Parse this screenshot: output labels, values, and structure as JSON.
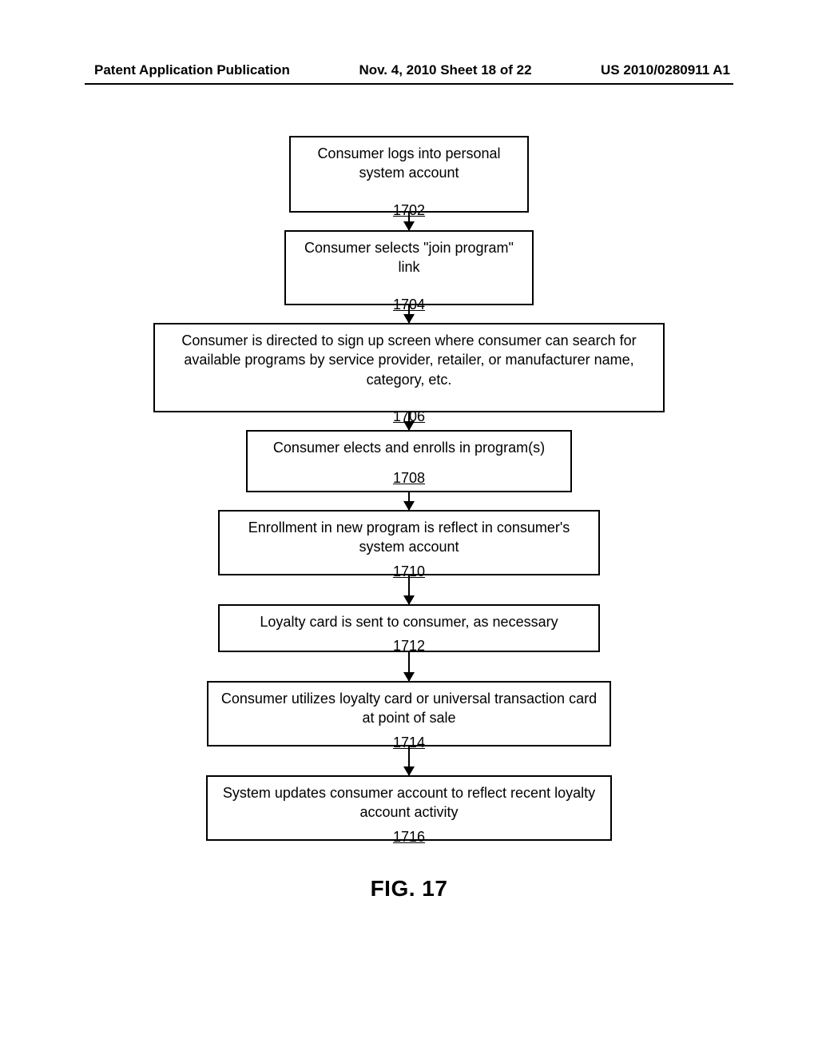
{
  "header": {
    "left": "Patent Application Publication",
    "center": "Nov. 4, 2010   Sheet 18 of 22",
    "right": "US 2010/0280911 A1"
  },
  "figure": {
    "label": "FIG. 17",
    "steps": [
      {
        "id": "1702",
        "text": "Consumer logs into personal system account",
        "ref": "1702"
      },
      {
        "id": "1704",
        "text": "Consumer selects \"join program\" link",
        "ref": "1704"
      },
      {
        "id": "1706",
        "text": "Consumer is directed to sign up screen where consumer can search for available programs by service provider, retailer, or manufacturer name, category, etc.",
        "ref": "1706"
      },
      {
        "id": "1708",
        "text": "Consumer elects and enrolls in program(s)",
        "ref": "1708"
      },
      {
        "id": "1710",
        "text": "Enrollment in new program is reflect in consumer's system account",
        "ref": "1710"
      },
      {
        "id": "1712",
        "text": "Loyalty card is sent to consumer, as necessary",
        "ref": "1712"
      },
      {
        "id": "1714",
        "text": "Consumer utilizes loyalty card or universal transaction card at point of sale",
        "ref": "1714"
      },
      {
        "id": "1716",
        "text": "System updates consumer account to reflect recent loyalty account activity",
        "ref": "1716"
      }
    ]
  }
}
